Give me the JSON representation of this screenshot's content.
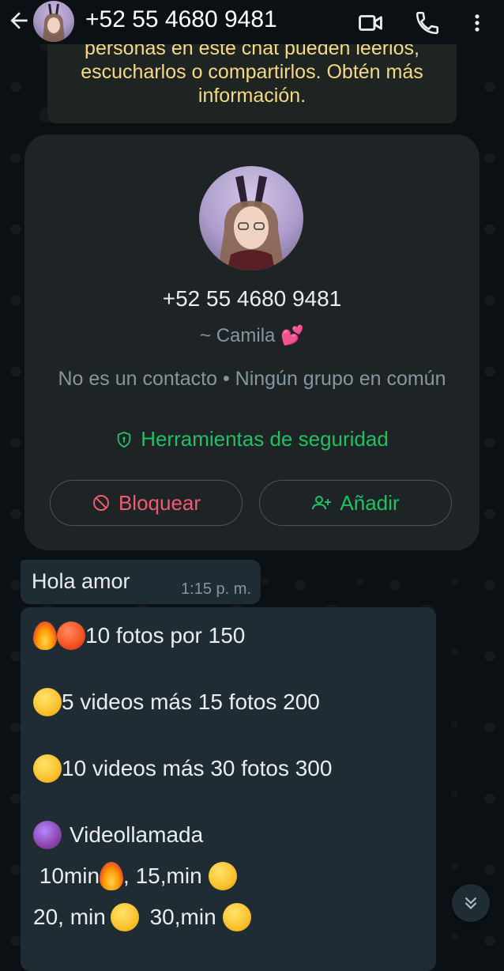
{
  "header": {
    "title": "+52 55 4680 9481",
    "icons": [
      "back-arrow-icon",
      "video-call-icon",
      "phone-call-icon",
      "more-vert-icon"
    ]
  },
  "notice": {
    "text": "personas en este chat pueden leerlos, escucharlos o compartirlos. Obtén más información."
  },
  "contact_card": {
    "phone": "+52 55 4680 9481",
    "name": "~ Camila 💕",
    "meta": "No es un contacto • Ningún grupo en común",
    "safety_label": "Herramientas de seguridad",
    "block_label": "Bloquear",
    "add_label": "Añadir"
  },
  "messages": [
    {
      "text": "Hola amor",
      "time": "1:15 p. m."
    },
    {
      "lines": [
        "10 fotos por 150",
        "5 videos más 15 fotos 200",
        "10 videos más 30 fotos 300",
        "Videollamada",
        " 10min",
        ", 15,min",
        "20, min",
        " 30,min"
      ]
    }
  ],
  "colors": {
    "background": "#0b1014",
    "bubble": "#202c33",
    "accent_green": "#21c063",
    "danger_red": "#f15c6d",
    "notice_text": "#f6d986"
  }
}
